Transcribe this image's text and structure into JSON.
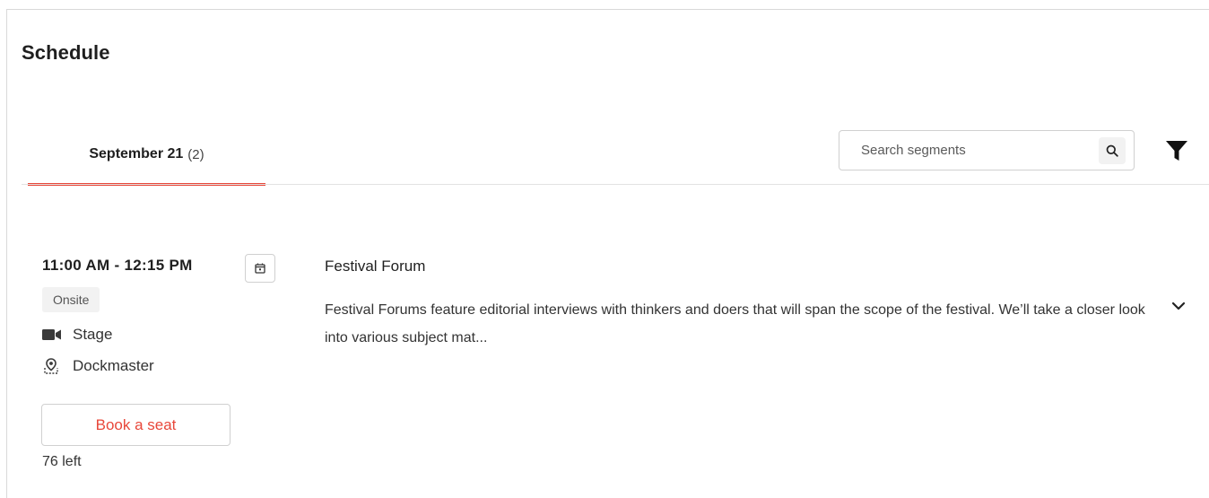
{
  "page": {
    "title": "Schedule"
  },
  "tabs": [
    {
      "label": "September 21",
      "count": "(2)",
      "active": true
    }
  ],
  "search": {
    "placeholder": "Search segments",
    "value": ""
  },
  "icons": {
    "search": "search-icon",
    "filter": "filter-icon",
    "calendar": "calendar-icon",
    "video": "video-camera-icon",
    "location": "map-pin-icon",
    "expand": "chevron-down-icon"
  },
  "colors": {
    "accent": "#e8473a",
    "border": "#d0d0d0",
    "badge_bg": "#f2f2f2"
  },
  "sessions": [
    {
      "time": "11:00 AM - 12:15 PM",
      "badge": "Onsite",
      "format": "Stage",
      "venue": "Dockmaster",
      "book_label": "Book a seat",
      "seats_left": "76 left",
      "title": "Festival Forum",
      "description": "Festival Forums feature editorial interviews with thinkers and doers that will span the scope of the festival. We’ll take a closer look into various subject mat..."
    }
  ]
}
